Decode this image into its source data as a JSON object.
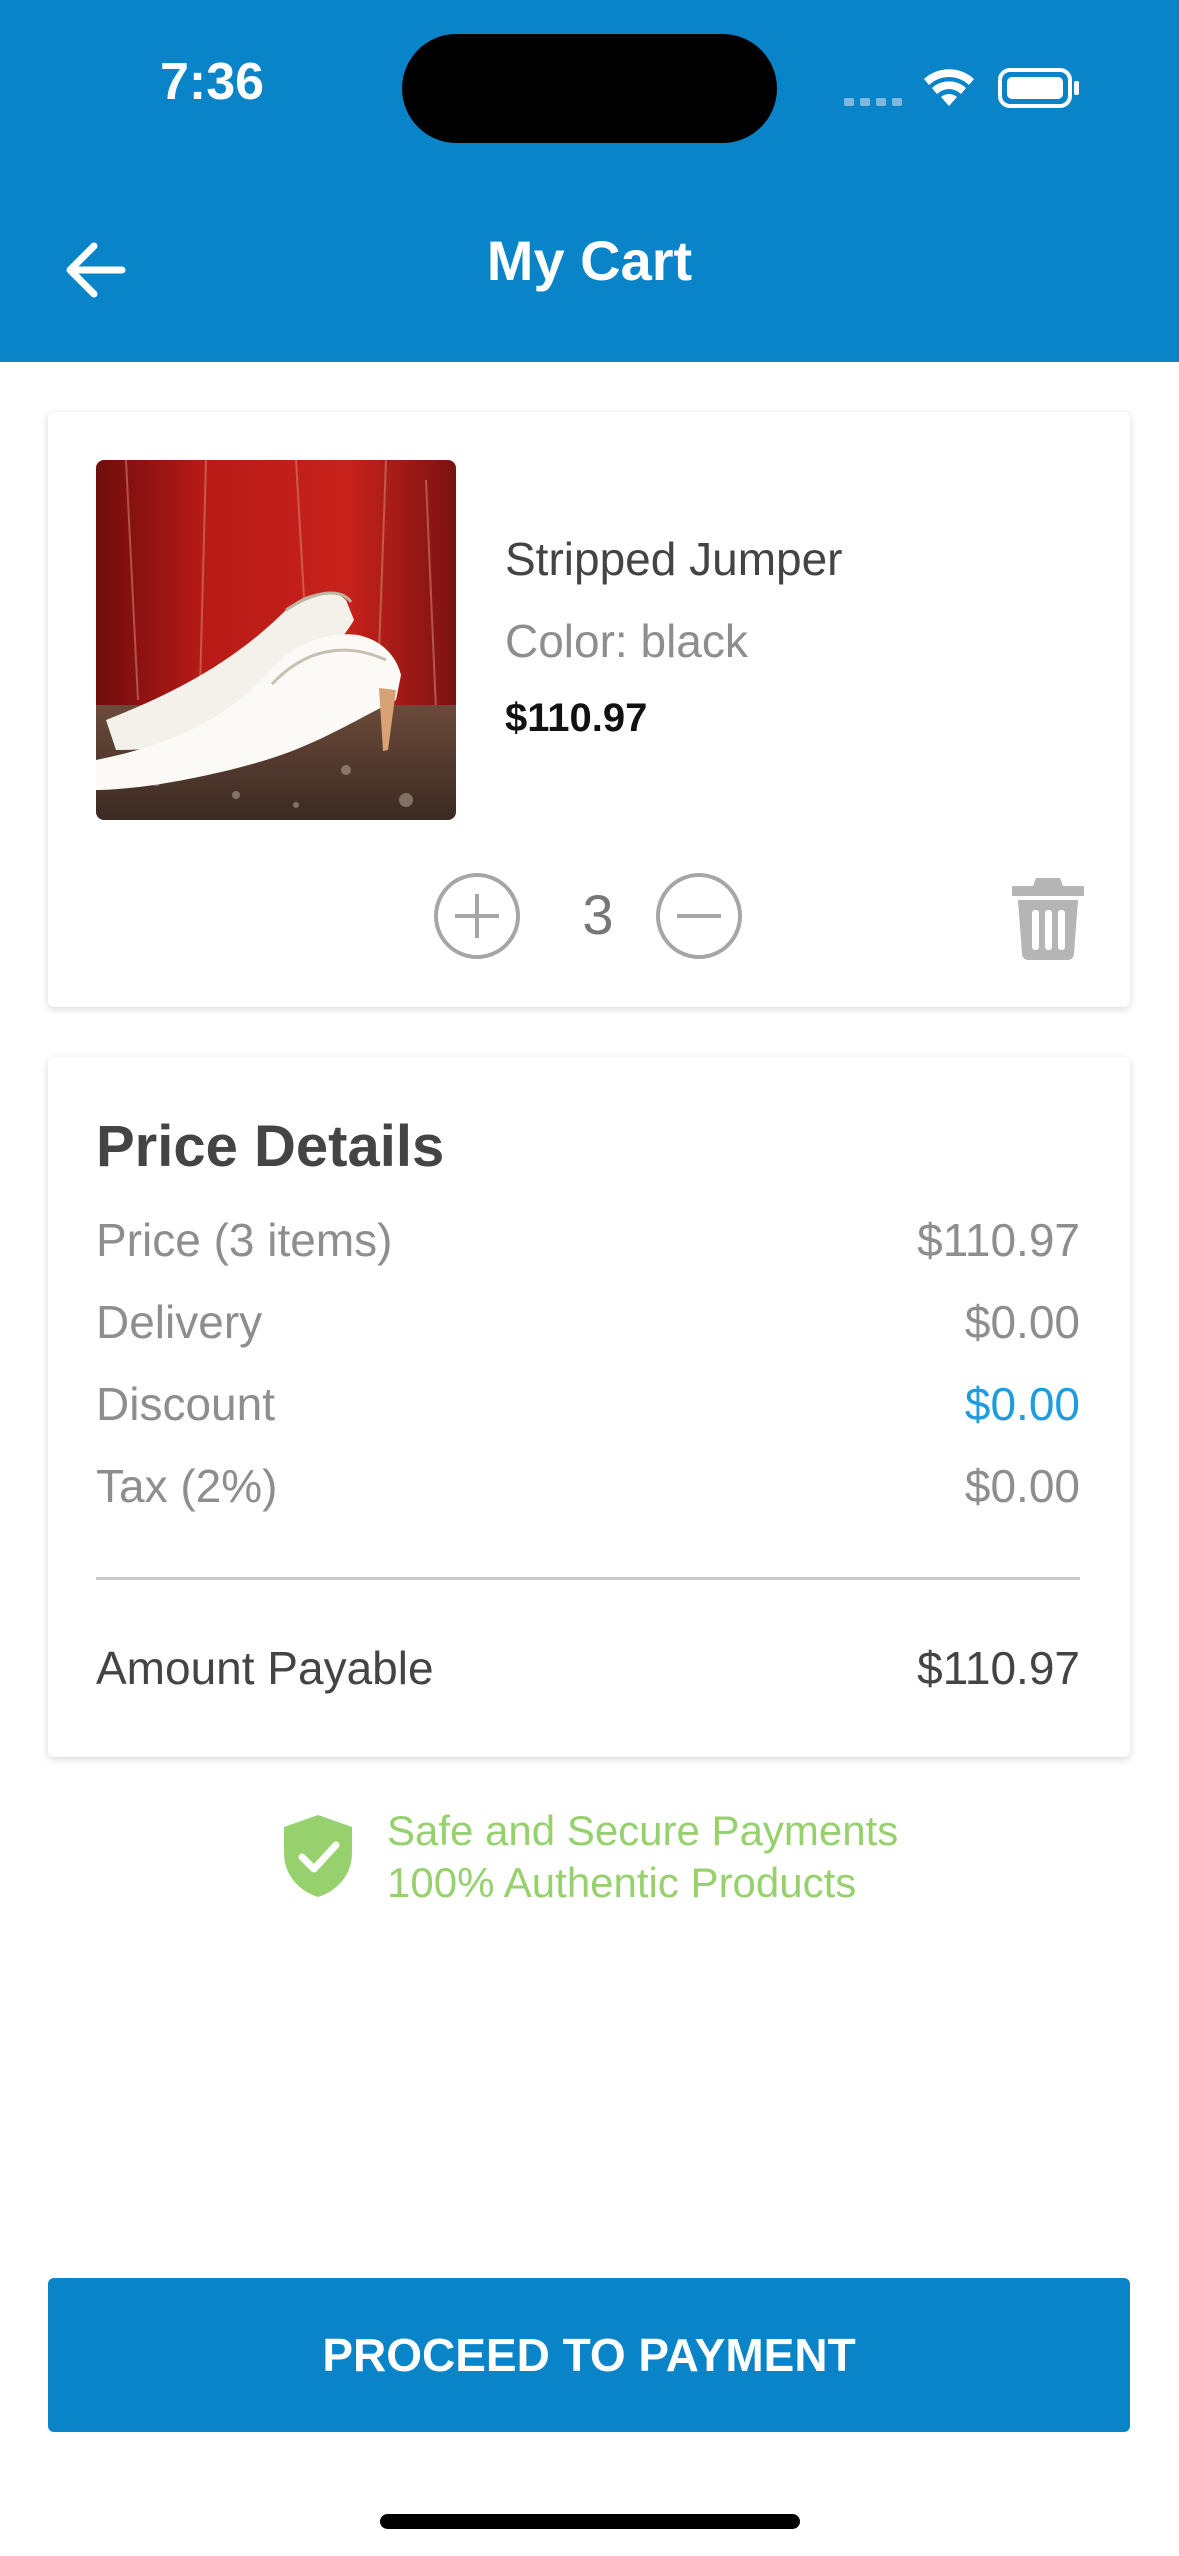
{
  "status_bar": {
    "time": "7:36"
  },
  "header": {
    "title": "My Cart"
  },
  "cart_item": {
    "name": "Stripped Jumper",
    "color": "Color: black",
    "price": "$110.97",
    "quantity": "3"
  },
  "price_details": {
    "title": "Price Details",
    "rows": [
      {
        "label": "Price (3 items)",
        "value": "$110.97"
      },
      {
        "label": "Delivery",
        "value": "$0.00"
      },
      {
        "label": "Discount",
        "value": "$0.00"
      },
      {
        "label": "Tax (2%)",
        "value": "$0.00"
      }
    ],
    "total": {
      "label": "Amount Payable",
      "value": "$110.97"
    }
  },
  "secure": {
    "line1": "Safe and Secure Payments",
    "line2": "100% Authentic Products"
  },
  "proceed_button": {
    "label": "PROCEED TO PAYMENT"
  },
  "colors": {
    "primary": "#0a84c8",
    "discount": "#1f9be0",
    "secure": "#97d16d"
  }
}
